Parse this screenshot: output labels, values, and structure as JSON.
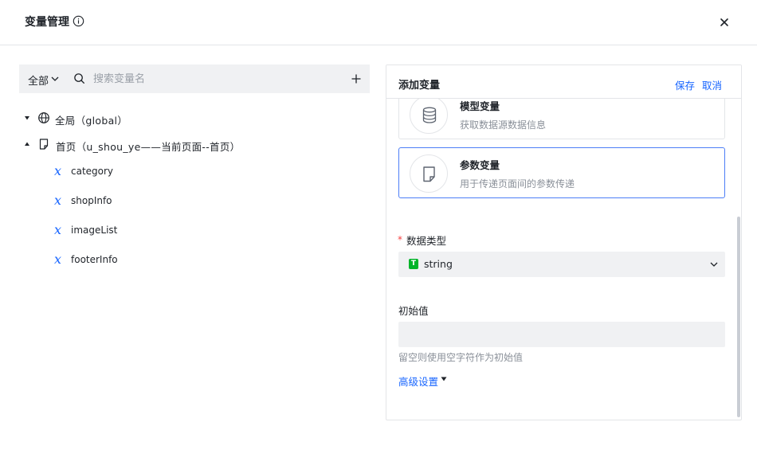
{
  "dialog": {
    "title": "变量管理",
    "close_icon": "close-icon",
    "info_icon": "info-icon"
  },
  "left": {
    "filter_label": "全部",
    "search_placeholder": "搜索变量名",
    "tree": {
      "global_label": "全局（global）",
      "page_label": "首页（u_shou_ye——当前页面--首页）",
      "variables": [
        "category",
        "shopInfo",
        "imageList",
        "footerInfo"
      ]
    }
  },
  "right": {
    "title": "添加变量",
    "save_label": "保存",
    "cancel_label": "取消",
    "cards": [
      {
        "title": "模型变量",
        "desc": "获取数据源数据信息",
        "icon": "database-icon"
      },
      {
        "title": "参数变量",
        "desc": "用于传递页面间的参数传递",
        "icon": "document-icon",
        "selected": true
      }
    ],
    "required_mark": "*",
    "data_type_label": "数据类型",
    "data_type_badge": "T",
    "data_type_value": "string",
    "initial_value_label": "初始值",
    "initial_value": "",
    "initial_hint": "留空则使用空字符作为初始值",
    "advanced_label": "高级设置"
  },
  "colors": {
    "accent": "#1664ff",
    "required": "#f53f3f",
    "string_badge": "#00b42a",
    "selected_border": "#4d7ef7"
  }
}
